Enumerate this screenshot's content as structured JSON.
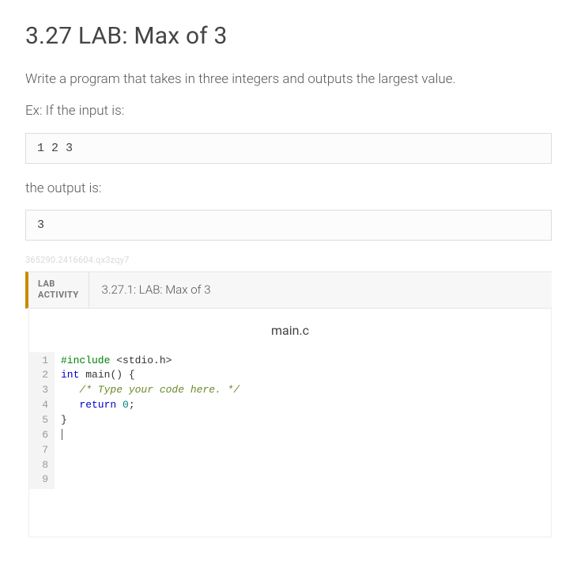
{
  "heading": "3.27 LAB: Max of 3",
  "description": "Write a program that takes in three integers and outputs the largest value.",
  "example_label_in": "Ex: If the input is:",
  "example_input": "1 2 3",
  "example_label_out": "the output is:",
  "example_output": "3",
  "watermark": "365290.2416604.qx3zqy7",
  "activity": {
    "badge_line1": "LAB",
    "badge_line2": "ACTIVITY",
    "title": "3.27.1: LAB: Max of 3"
  },
  "editor": {
    "filename": "main.c",
    "line_numbers": [
      "1",
      "2",
      "3",
      "4",
      "5",
      "6",
      "7",
      "8",
      "9"
    ],
    "code": {
      "l1": {
        "kw": "#include",
        "rest": " <stdio.h>"
      },
      "l2": "",
      "l3": {
        "t": "int",
        "n": "main",
        "rest": "() {"
      },
      "l4": "",
      "l5": "   /* Type your code here. */",
      "l6": "",
      "l7": {
        "pre": "   ",
        "kw": "return",
        "sp": " ",
        "num": "0",
        "tail": ";"
      },
      "l8": "}",
      "l9": ""
    }
  }
}
